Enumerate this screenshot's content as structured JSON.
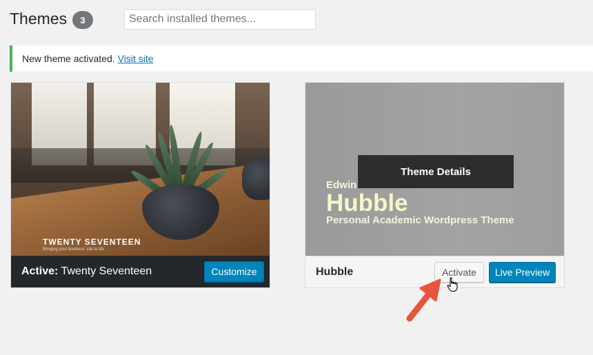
{
  "header": {
    "title": "Themes",
    "count": "3",
    "search_placeholder": "Search installed themes..."
  },
  "notice": {
    "text": "New theme activated.",
    "link": "Visit site"
  },
  "themes": [
    {
      "name": "Twenty Seventeen",
      "active_prefix": "Active:",
      "screenshot_logo": "TWENTY SEVENTEEN",
      "screenshot_tagline": "Bringing your business' site to life",
      "button": "Customize"
    },
    {
      "name": "Hubble",
      "screenshot_line1": "Edwin",
      "screenshot_line2": "Hubble",
      "screenshot_line3": "Personal Academic Wordpress Theme",
      "overlay": "Theme Details",
      "activate": "Activate",
      "live_preview": "Live Preview"
    }
  ],
  "icons": {
    "cursor": "hand-pointer-icon",
    "arrow": "red-annotation-arrow-icon"
  },
  "colors": {
    "accent": "#0085ba",
    "notice_border": "#46b450",
    "link": "#0073aa",
    "annotation": "#e8553e"
  }
}
